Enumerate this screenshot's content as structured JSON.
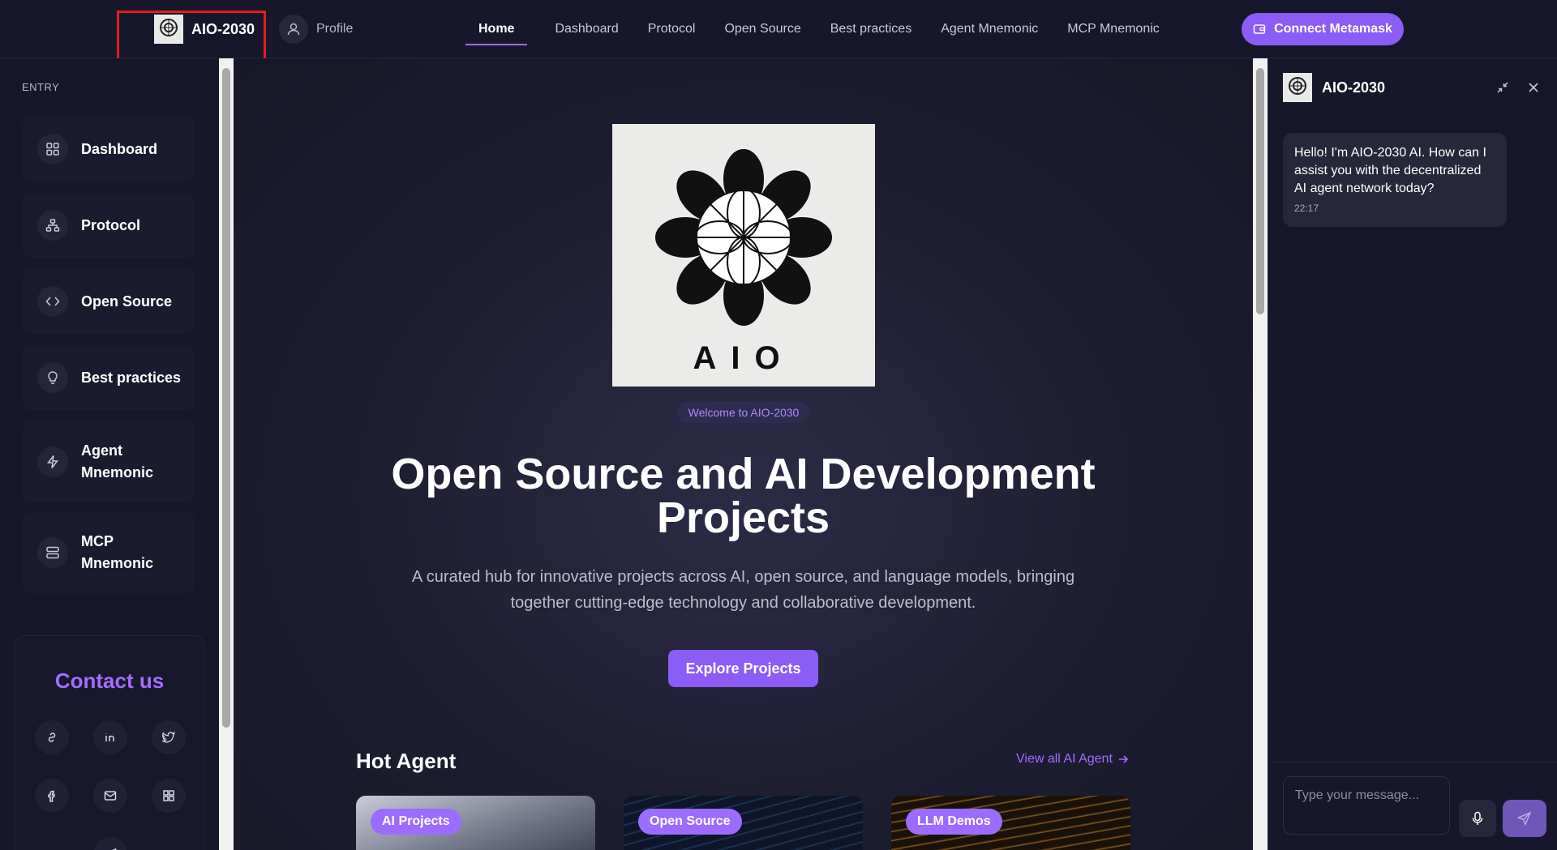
{
  "header": {
    "brand": "AIO-2030",
    "profile": "Profile",
    "nav": [
      "Home",
      "Dashboard",
      "Protocol",
      "Open Source",
      "Best practices",
      "Agent Mnemonic",
      "MCP Mnemonic"
    ],
    "active_nav": "Home",
    "connect_label": "Connect Metamask"
  },
  "sidebar": {
    "title": "ENTRY",
    "items": [
      {
        "label": "Dashboard",
        "icon": "grid-icon"
      },
      {
        "label": "Protocol",
        "icon": "network-icon"
      },
      {
        "label": "Open Source",
        "icon": "code-icon"
      },
      {
        "label": "Best practices",
        "icon": "lightbulb-icon"
      },
      {
        "label": "Agent Mnemonic",
        "icon": "bolt-icon"
      },
      {
        "label": "MCP Mnemonic",
        "icon": "server-icon"
      }
    ],
    "contact_title": "Contact us",
    "contact_icons": [
      "link-icon",
      "linkedin-icon",
      "twitter-icon",
      "facebook-icon",
      "mail-icon",
      "apps-icon",
      "telegram-icon"
    ]
  },
  "hero": {
    "logo_text": "AIO",
    "badge": "Welcome to AIO-2030",
    "title": "Open Source and AI Development Projects",
    "subtitle": "A curated hub for innovative projects across AI, open source, and language models, bringing together cutting-edge technology and collaborative development.",
    "cta": "Explore Projects"
  },
  "hot_agent": {
    "title": "Hot Agent",
    "view_all": "View all AI Agent",
    "cards": [
      {
        "tag": "AI Projects"
      },
      {
        "tag": "Open Source"
      },
      {
        "tag": "LLM Demos"
      }
    ]
  },
  "chat": {
    "title": "AIO-2030",
    "message": "Hello! I'm AIO-2030 AI. How can I assist you with the decentralized AI agent network today?",
    "time": "22:17",
    "input_placeholder": "Type your message..."
  },
  "colors": {
    "accent": "#8b5cf6",
    "contact": "#a36dff",
    "highlight": "#e01d1d"
  }
}
